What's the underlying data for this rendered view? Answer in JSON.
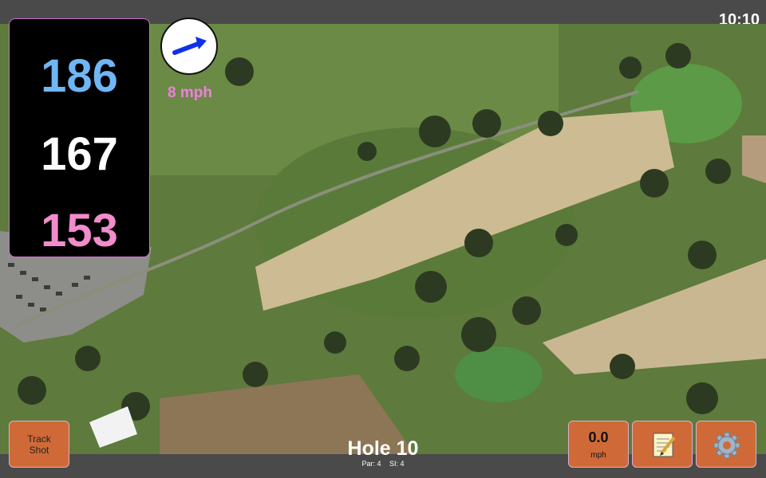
{
  "clock": "10:10",
  "yardage": {
    "back": "186",
    "middle": "167",
    "front": "153"
  },
  "wind": {
    "speed_text": "8 mph",
    "icon": "wind-arrow-icon"
  },
  "buttons": {
    "track_shot": "Track Shot",
    "speed_value": "0.0",
    "speed_unit": "mph",
    "notes_icon": "notepad-icon",
    "settings_icon": "gear-icon"
  },
  "hole": {
    "title": "Hole 10",
    "par": "Par: 4",
    "si": "SI: 4"
  },
  "colors": {
    "back": "#6fb6f5",
    "middle": "#ffffff",
    "front": "#f28ccc",
    "wind_text": "#f07ee0",
    "button": "#cf6a38"
  }
}
